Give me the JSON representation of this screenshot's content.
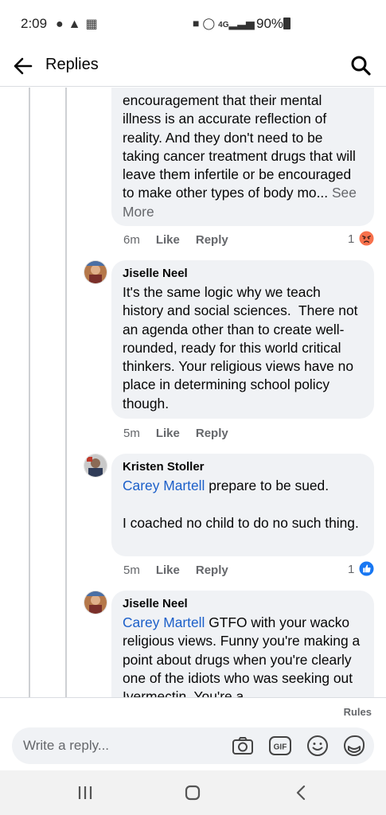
{
  "status_bar": {
    "time": "2:09",
    "left_icons": [
      "snapchat-icon",
      "navigation-arrow-icon",
      "gallery-icon"
    ],
    "right_icons": [
      "lock-icon",
      "alarm-icon",
      "4g-lte-icon",
      "signal-icon"
    ],
    "battery": "90%"
  },
  "header": {
    "title": "Replies"
  },
  "comments": [
    {
      "segments": [
        {
          "text": "encouragement that their mental illness is an accurate reflection of reality. And they don't need to be taking cancer treatment drugs that will leave them infertile or be encouraged to make other types of body mo... ",
          "kind": "plain"
        },
        {
          "text": "See More",
          "kind": "see-more"
        }
      ],
      "time": "6m",
      "like": "Like",
      "reply": "Reply",
      "reaction_count": "1",
      "reaction_type": "angry"
    },
    {
      "author": "Jiselle Neel",
      "segments": [
        {
          "text": "It's the same logic why we teach history and social sciences.  There not an agenda other than to create well-rounded, ready for this world critical thinkers. Your religious views have no place in determining school policy though.",
          "kind": "plain"
        }
      ],
      "time": "5m",
      "like": "Like",
      "reply": "Reply"
    },
    {
      "author": "Kristen Stoller",
      "segments": [
        {
          "text": "Carey Martell",
          "kind": "mention"
        },
        {
          "text": " prepare to be sued.\n\nI coached no child to do no such thing.",
          "kind": "plain"
        }
      ],
      "time": "5m",
      "like": "Like",
      "reply": "Reply",
      "reaction_count": "1",
      "reaction_type": "like"
    },
    {
      "author": "Jiselle Neel",
      "segments": [
        {
          "text": "Carey Martell",
          "kind": "mention"
        },
        {
          "text": " GTFO with your wacko religious views. Funny you're making a point about drugs when you're clearly one of the idiots who was seeking out Ivermectin. You're a",
          "kind": "plain"
        }
      ]
    }
  ],
  "composer": {
    "rules": "Rules",
    "placeholder": "Write a reply...",
    "icons": [
      "camera-icon",
      "gif-icon",
      "emoji-icon",
      "sticker-icon"
    ]
  },
  "nav": {
    "icons": [
      "recent-apps-icon",
      "home-icon",
      "back-icon"
    ]
  },
  "colors": {
    "link": "#1b5fc9",
    "bubble": "#f0f2f5",
    "like_blue": "#1877f2",
    "angry_orange": "#f7714c",
    "secondary_text": "#65676b"
  }
}
